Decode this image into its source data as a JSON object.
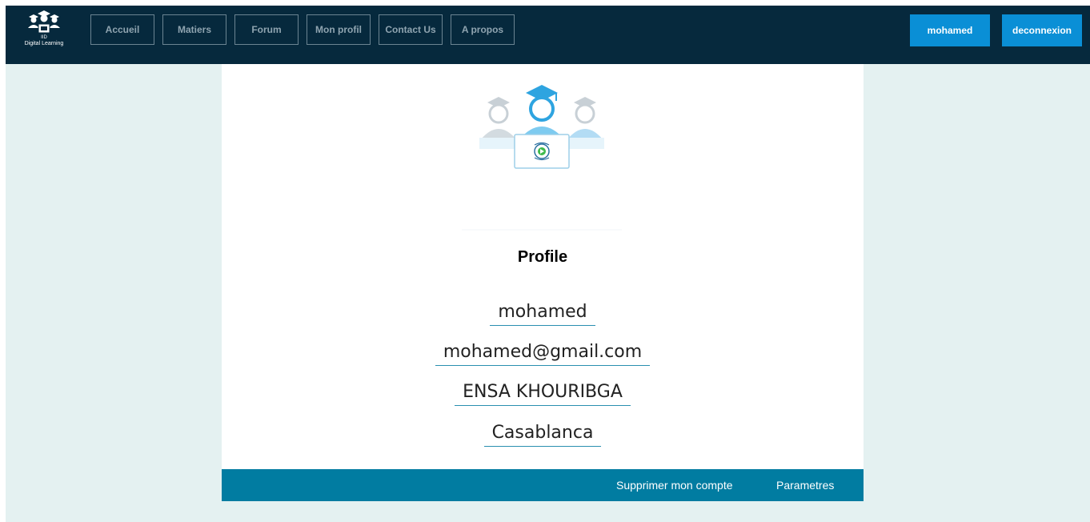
{
  "brand": {
    "line1": "IID",
    "line2": "Digital Learning"
  },
  "nav": {
    "items": [
      "Accueil",
      "Matiers",
      "Forum",
      "Mon profil",
      "Contact Us",
      "A propos"
    ]
  },
  "user_button": "mohamed",
  "logout_button": "deconnexion",
  "profile": {
    "title": "Profile",
    "username": "mohamed",
    "email": "mohamed@gmail.com",
    "school": "ENSA KHOURIBGA",
    "city": "Casablanca"
  },
  "footer": {
    "delete_account": "Supprimer mon compte",
    "settings": "Parametres"
  },
  "colors": {
    "navbar": "#06293d",
    "accent_button": "#0a8fd6",
    "footer_bar": "#017ca1",
    "page_background": "#e4f1f1"
  },
  "icons": [
    "graduates-logo-icon",
    "students-laptop-illustration",
    "play-icon"
  ]
}
